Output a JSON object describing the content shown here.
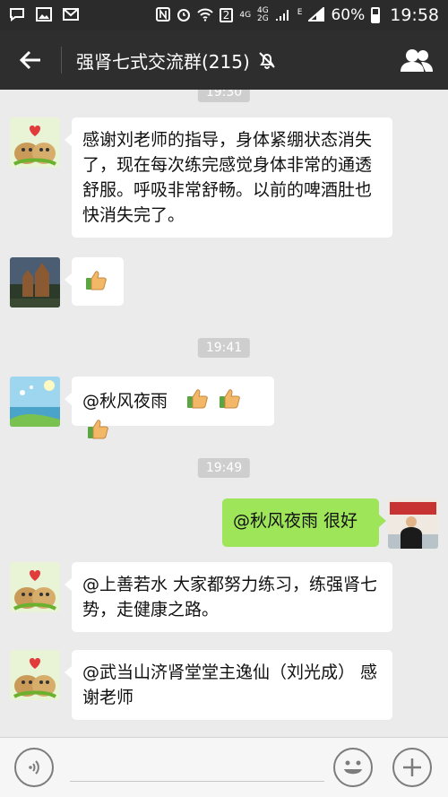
{
  "status_bar": {
    "signal_4g_1": "4G",
    "signal_4g_2": "4G",
    "signal_2g": "2G",
    "sim_label": "2",
    "edge_label": "E",
    "battery_pct": "60%",
    "time": "19:58"
  },
  "header": {
    "title": "强肾七式交流群(215)"
  },
  "messages": [
    {
      "time": "19:30"
    },
    {
      "text": "感谢刘老师的指导，身体紧绷状态消失了，现在每次练完感觉身体非常的通透舒服。呼吸非常舒畅。以前的啤酒肚也快消失完了。"
    },
    {
      "text": ""
    },
    {
      "time": "19:41"
    },
    {
      "text": "@秋风夜雨"
    },
    {
      "time": "19:49"
    },
    {
      "text": "@秋风夜雨 很好"
    },
    {
      "text": "@上善若水 大家都努力练习，练强肾七势，走健康之路。"
    },
    {
      "text": "@武当山济肾堂堂主逸仙（刘光成） 感谢老师"
    }
  ],
  "colors": {
    "header_bg": "#2e2e2e",
    "chat_bg": "#ebebeb",
    "own_bubble": "#9ee55a",
    "other_bubble": "#ffffff"
  }
}
